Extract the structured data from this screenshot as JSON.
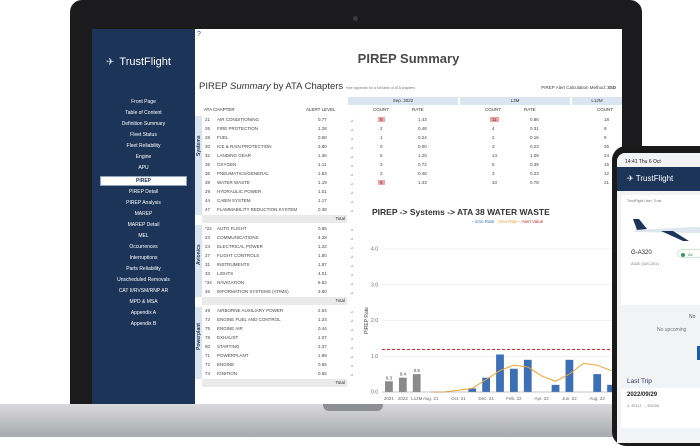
{
  "sidebar": {
    "logo": "TrustFlight",
    "items": [
      {
        "label": "Front Page"
      },
      {
        "label": "Table of Content"
      },
      {
        "label": "Definition Summary"
      },
      {
        "label": "Fleet Status"
      },
      {
        "label": "Fleet Reliability"
      },
      {
        "label": "Engine"
      },
      {
        "label": "APU"
      },
      {
        "label": "PIREP",
        "active": true
      },
      {
        "label": "PIREP Detail"
      },
      {
        "label": "PIREP Analysis"
      },
      {
        "label": "MAREP"
      },
      {
        "label": "MAREP Detail"
      },
      {
        "label": "MEL"
      },
      {
        "label": "Occurrences"
      },
      {
        "label": "Interruptions"
      },
      {
        "label": "Parts Reliability"
      },
      {
        "label": "Unscheduled Removals"
      },
      {
        "label": "CAT II/RVSM/RNP AR"
      },
      {
        "label": "MPD & MSA"
      },
      {
        "label": "Appendix A"
      },
      {
        "label": "Appendix B"
      }
    ]
  },
  "help": "?",
  "page_title": "PIREP Summary",
  "subtitle": {
    "a": "PIREP ",
    "b": "Summary",
    "c": " by ATA Chapters ",
    "note": "*see appendix for a full table of ATA chapters"
  },
  "alert_calc": {
    "label": "PIREP Alert Calculation Method: ",
    "value": "3SD"
  },
  "periods": [
    "Sep. 2022",
    "L3M",
    "L12M"
  ],
  "col_headers": {
    "ata": "ATA CHAPTER",
    "alert": "ALERT LEVEL",
    "count": "COUNT",
    "rate": "RATE"
  },
  "groups": [
    "Systems",
    "Avionics",
    "Powerplant"
  ],
  "total_label": "Total",
  "rows_systems": [
    {
      "code": "21",
      "name": "AIR CONDITIONING",
      "alert": "0.77",
      "c1": "6",
      "r1": "1.43",
      "c2": "11",
      "r2": "0.86",
      "c3": "18",
      "r3": "0.51",
      "h1": true,
      "h2": true
    },
    {
      "code": "26",
      "name": "FIRE PROTECTION",
      "alert": "1.28",
      "c1": "2",
      "r1": "0.48",
      "c2": "4",
      "r2": "0.31",
      "c3": "9",
      "r3": "0.26"
    },
    {
      "code": "28",
      "name": "FUEL",
      "alert": "0.68",
      "c1": "1",
      "r1": "0.24",
      "c2": "2",
      "r2": "0.16",
      "c3": "9",
      "r3": "0.26"
    },
    {
      "code": "30",
      "name": "ICE & RAIN PROTECTION",
      "alert": "3.80",
      "c1": "0",
      "r1": "0.00",
      "c2": "3",
      "r2": "0.23",
      "c3": "26",
      "r3": ""
    },
    {
      "code": "32",
      "name": "LANDING GEAR",
      "alert": "1.36",
      "c1": "5",
      "r1": "1.20",
      "c2": "14",
      "r2": "1.09",
      "c3": "24",
      "r3": ""
    },
    {
      "code": "35",
      "name": "OXYGEN",
      "alert": "1.11",
      "c1": "3",
      "r1": "0.72",
      "c2": "5",
      "r2": "0.39",
      "c3": "15",
      "r3": ""
    },
    {
      "code": "36",
      "name": "PNEUMATICS/GENERAL",
      "alert": "1.63",
      "c1": "2",
      "r1": "0.48",
      "c2": "3",
      "r2": "0.23",
      "c3": "12",
      "r3": ""
    },
    {
      "code": "38",
      "name": "WATER WASTE",
      "alert": "1.19",
      "c1": "6",
      "r1": "1.43",
      "c2": "10",
      "r2": "0.78",
      "c3": "21",
      "r3": "",
      "h1": true
    },
    {
      "code": "29",
      "name": "HYDRAULIC POWER",
      "alert": "1.01"
    },
    {
      "code": "44",
      "name": "CABIN SYSTEM",
      "alert": "1.17"
    },
    {
      "code": "47",
      "name": "FLAMMABILITY REDUCTION SYSTEM",
      "alert": "0.38"
    }
  ],
  "rows_avionics": [
    {
      "code": "*22",
      "name": "AUTO FLIGHT",
      "alert": "0.95"
    },
    {
      "code": "23",
      "name": "COMMUNICATIONS",
      "alert": "4.28"
    },
    {
      "code": "24",
      "name": "ELECTRICAL POWER",
      "alert": "1.22"
    },
    {
      "code": "27",
      "name": "FLIGHT CONTROLS",
      "alert": "1.80"
    },
    {
      "code": "31",
      "name": "INSTRUMENTS",
      "alert": "1.87"
    },
    {
      "code": "33",
      "name": "LIGHTS",
      "alert": "4.01"
    },
    {
      "code": "*34",
      "name": "NAVIGATION",
      "alert": "6.52"
    },
    {
      "code": "46",
      "name": "INFORMATION SYSTEMS (ATIMS)",
      "alert": "3.80"
    }
  ],
  "rows_powerplant": [
    {
      "code": "49",
      "name": "AIRBORNE AUXILIARY POWER",
      "alert": "2.64"
    },
    {
      "code": "73",
      "name": "ENGINE FUEL AND CONTROL",
      "alert": "1.24"
    },
    {
      "code": "75",
      "name": "ENGINE AIR",
      "alert": "0.44"
    },
    {
      "code": "78",
      "name": "EXHAUST",
      "alert": "1.07"
    },
    {
      "code": "80",
      "name": "STARTING",
      "alert": "2.37"
    },
    {
      "code": "71",
      "name": "POWERPLANT",
      "alert": "1.89"
    },
    {
      "code": "72",
      "name": "ENGINE",
      "alert": "0.55"
    },
    {
      "code": "74",
      "name": "IGNITION",
      "alert": "0.55"
    }
  ],
  "chart_data": {
    "type": "bar",
    "title": "PIREP -> Systems -> ATA 38 WATER WASTE",
    "legend": [
      {
        "label": "- 1mo Rate",
        "color": "#3b6fb6"
      },
      {
        "label": "- 3mo Rate",
        "color": "#f0a030"
      },
      {
        "label": "- Alert Value",
        "color": "#d62b2b"
      }
    ],
    "ylabel": "PIREP Rate",
    "ylim": [
      0,
      4.0
    ],
    "yticks": [
      "0.0",
      "1.0",
      "2.0",
      "3.0",
      "4.0"
    ],
    "categories": [
      "2021",
      "2022",
      "L12M",
      "Aug. 21",
      "",
      "Oct. 21",
      "",
      "Dec. 21",
      "",
      "Feb. 22",
      "",
      "Apr. 22",
      "",
      "Jun. 22",
      "",
      "Aug. 22",
      ""
    ],
    "bar_values": [
      0.3,
      0.4,
      0.5,
      0,
      0,
      0,
      0.1,
      0.4,
      1.05,
      0.65,
      0.9,
      0,
      0.2,
      0.9,
      0,
      0.5,
      0.2
    ],
    "bar_labels": [
      "0.3",
      "0.4",
      "0.5",
      "",
      "",
      "",
      "",
      "",
      "",
      "",
      "",
      "",
      "",
      "",
      "",
      "",
      ""
    ],
    "line_3mo": [
      null,
      null,
      null,
      0,
      0,
      0.05,
      0.1,
      0.35,
      0.6,
      0.75,
      0.7,
      0.45,
      0.3,
      0.5,
      0.8,
      0.75,
      0.6
    ],
    "alert_value": 1.19,
    "colors": {
      "bar_summary": "#8a8a8a",
      "bar": "#3b6fb6",
      "line": "#f0a030",
      "alert": "#d62b2b"
    }
  },
  "phone": {
    "time": "14:41  Thu 6 Oct",
    "logo": "TrustFlight",
    "user": "TrustFlight User, Trust",
    "reg": "G-A320",
    "type": "A320 (320-201)",
    "status": "Air",
    "no1": "No",
    "no2": "No upcoming",
    "last_trip": "Last Trip",
    "trip_date": "2022/09/29",
    "trip_route": "1. EGJJ  →  EGGB"
  }
}
